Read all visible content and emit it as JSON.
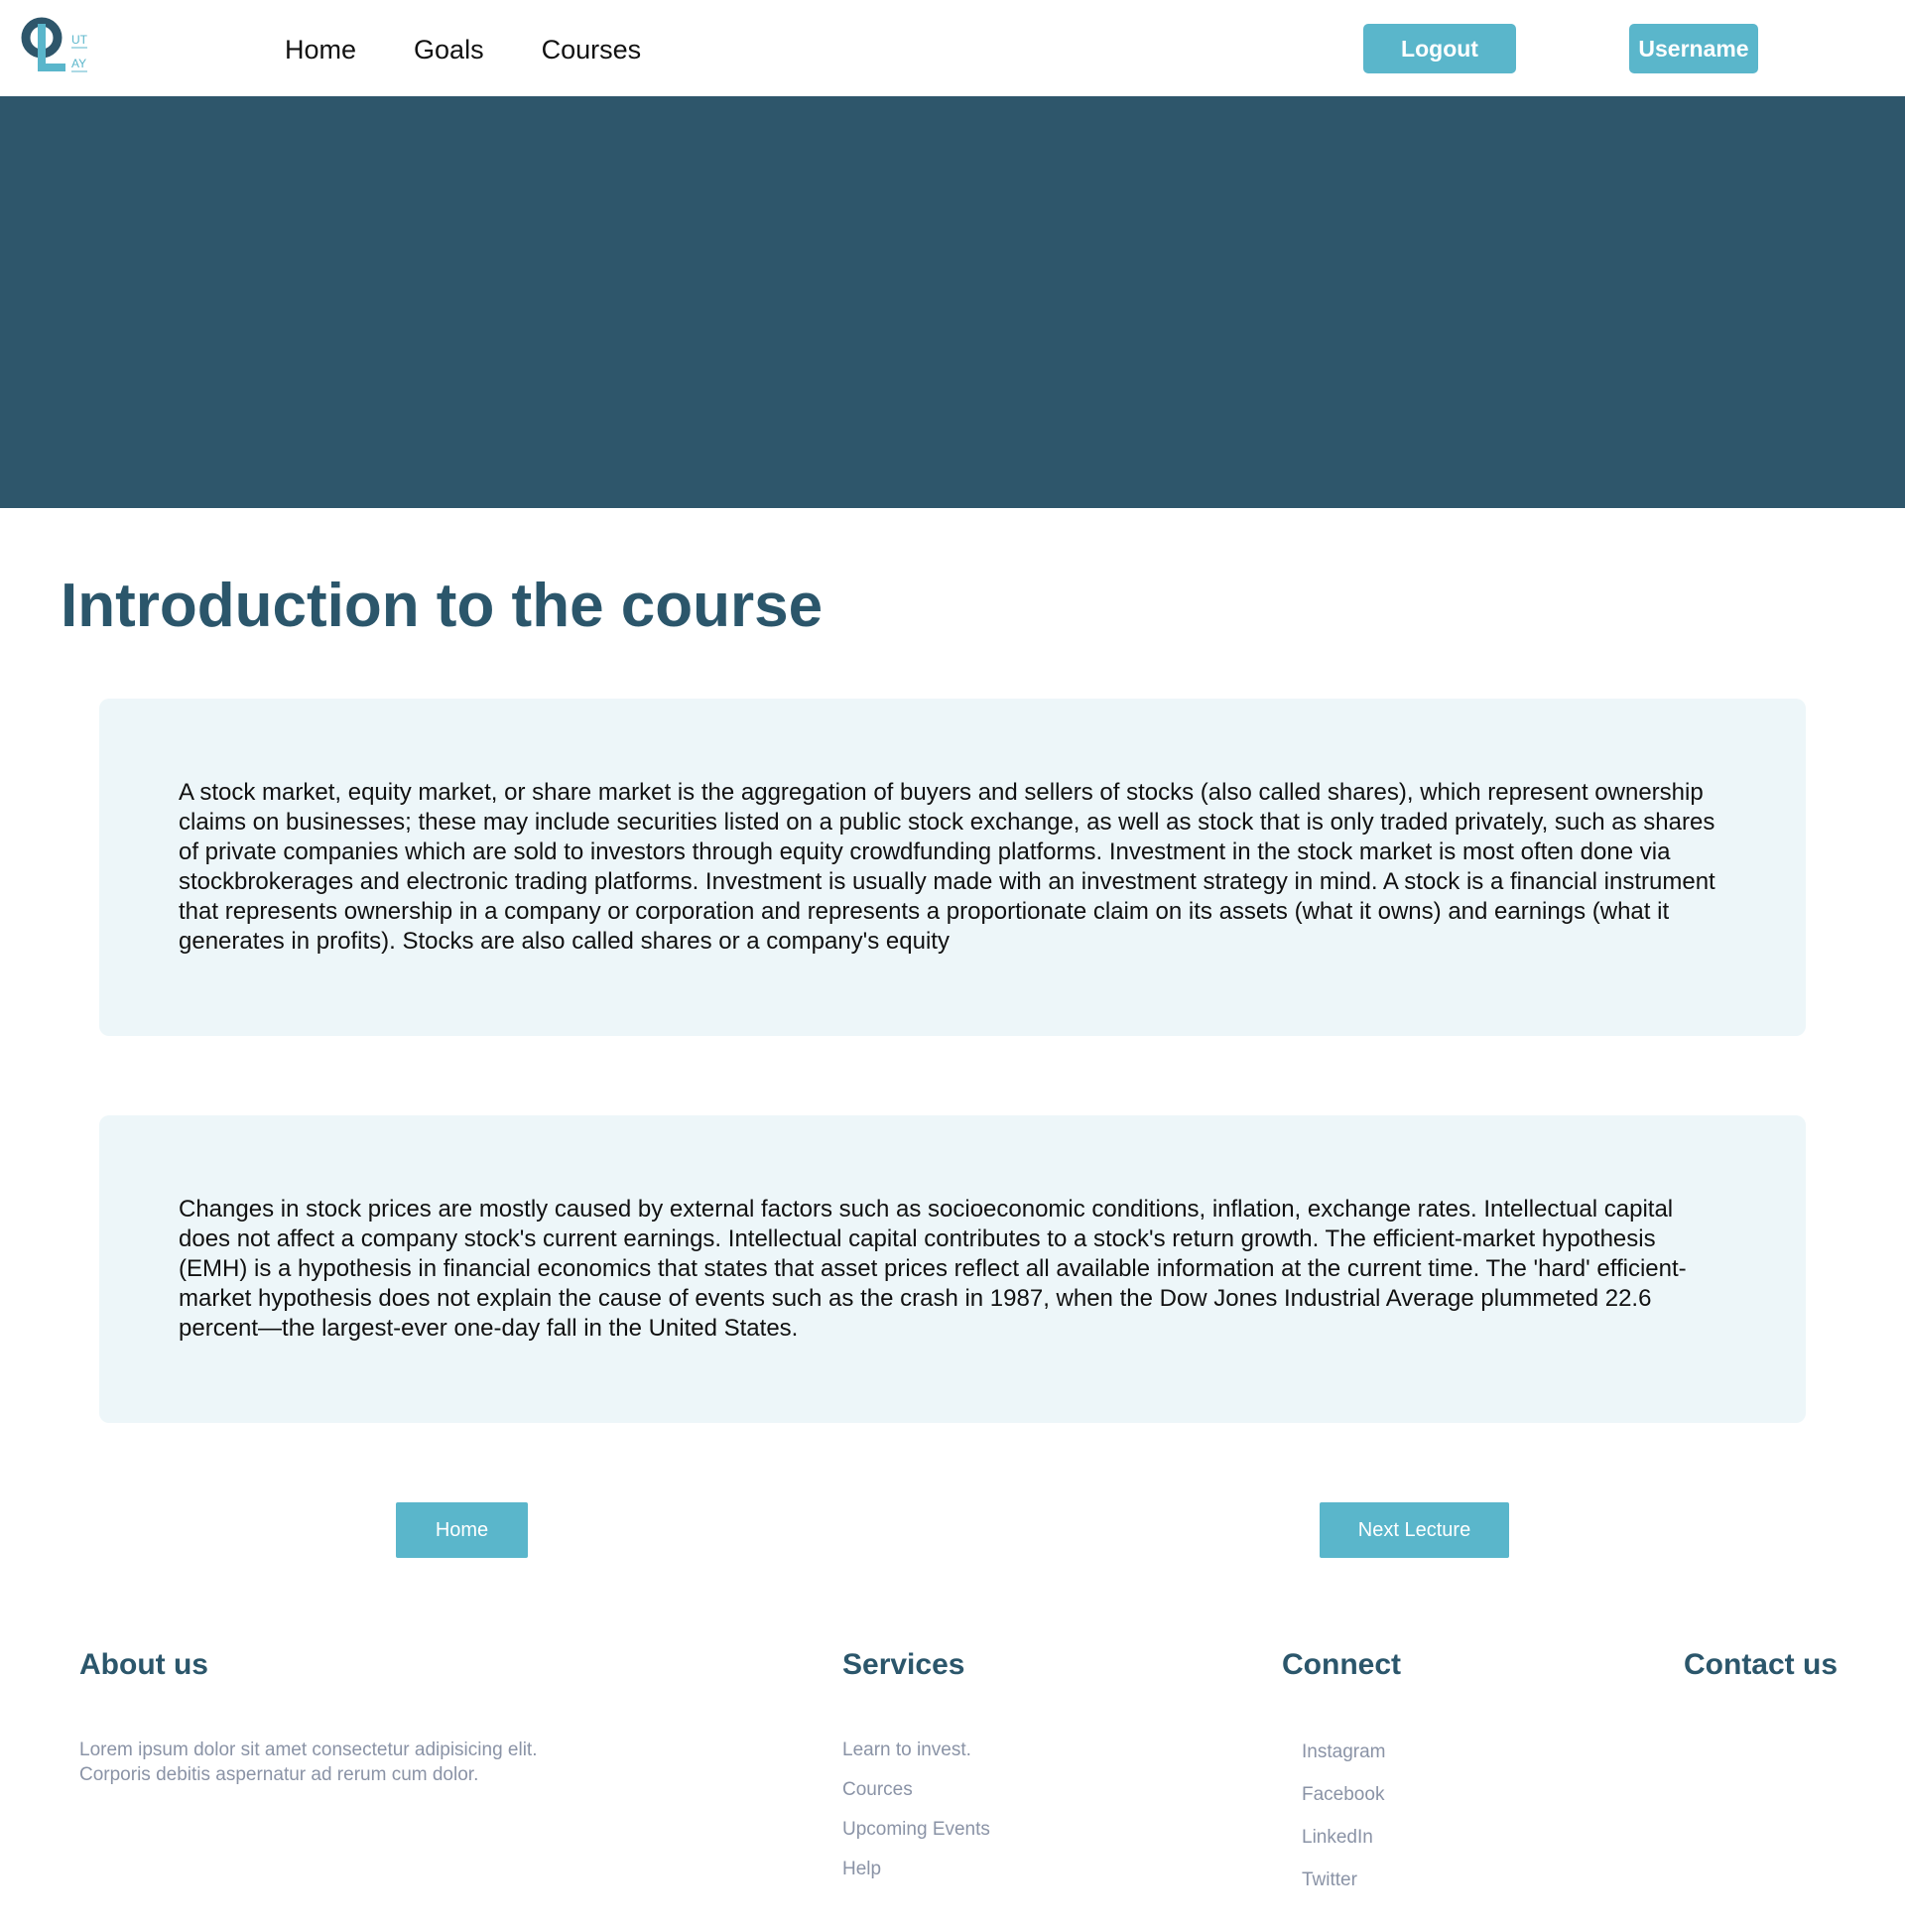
{
  "header": {
    "logo": {
      "letters_top": "UT",
      "letters_bottom": "AY",
      "colors": {
        "ring": "#2e566b",
        "accent": "#5ab6cb"
      }
    },
    "nav": [
      {
        "label": "Home"
      },
      {
        "label": "Goals"
      },
      {
        "label": "Courses"
      }
    ],
    "logout_label": "Logout",
    "username_label": "Username"
  },
  "hero": {
    "color": "#2e566b"
  },
  "main": {
    "title": "Introduction to the course",
    "paragraphs": [
      "A stock market, equity market, or share market is the aggregation of buyers and sellers of stocks (also called shares), which represent ownership claims on businesses; these may include securities listed on a public stock exchange, as well as stock that is only traded privately, such as shares of private companies which are sold to investors through equity crowdfunding platforms. Investment in the stock market is most often done via stockbrokerages and electronic trading platforms. Investment is usually made with an investment strategy in mind. A stock is a financial instrument that represents ownership in a company or corporation and represents a proportionate claim on its assets (what it owns) and earnings (what it generates in profits). Stocks are also called shares or a company's equity",
      "Changes in stock prices are mostly caused by external factors such as socioeconomic conditions, inflation, exchange rates. Intellectual capital does not affect a company stock's current earnings. Intellectual capital contributes to a stock's return growth. The efficient-market hypothesis (EMH) is a hypothesis in financial economics that states that asset prices reflect all available information at the current time. The 'hard' efficient-market hypothesis does not explain the cause of events such as the crash in 1987, when the Dow Jones Industrial Average plummeted 22.6 percent—the largest-ever one-day fall in the United States."
    ],
    "home_button": "Home",
    "next_button": "Next Lecture"
  },
  "footer": {
    "about": {
      "heading": "About us",
      "text": "Lorem ipsum dolor sit amet consectetur adipisicing elit. Corporis debitis aspernatur ad rerum cum dolor."
    },
    "services": {
      "heading": "Services",
      "items": [
        "Learn to invest.",
        "Cources",
        "Upcoming Events",
        "Help"
      ]
    },
    "connect": {
      "heading": "Connect",
      "items": [
        "Instagram",
        "Facebook",
        "LinkedIn",
        "Twitter"
      ]
    },
    "contact": {
      "heading": "Contact us"
    }
  },
  "colors": {
    "primary_dark": "#2e566b",
    "accent": "#5ab6cb",
    "card_bg": "#edf6f9",
    "muted_text": "#8a93a6"
  }
}
